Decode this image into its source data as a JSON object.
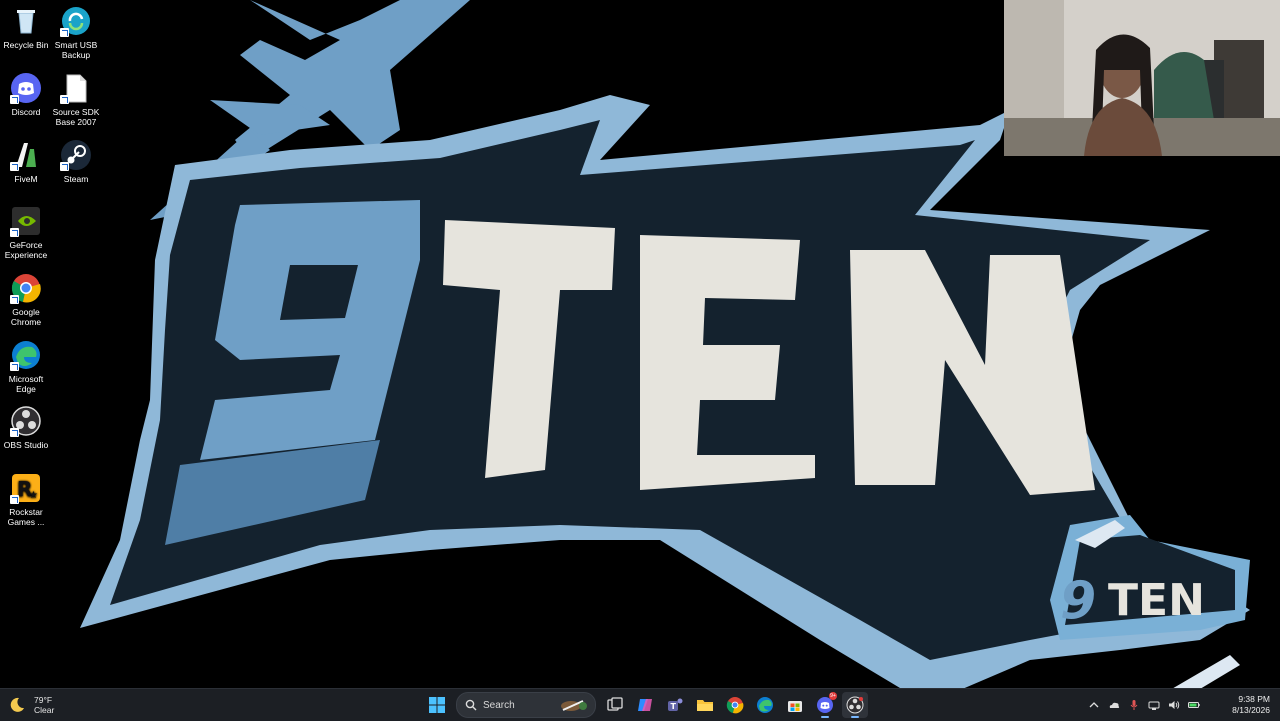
{
  "wallpaper": {
    "logo_text_nine": "9",
    "logo_text_word": "TEN",
    "small_logo_nine": "9",
    "small_logo_word": "TEN",
    "colors": {
      "light_blue": "#6f9fc6",
      "outline_blue": "#8fb8d8",
      "navy": "#14222e",
      "cream": "#e6e4dd"
    }
  },
  "desktop": {
    "icons": [
      {
        "label_line1": "Recycle Bin",
        "label_line2": "",
        "icon": "recycle-bin-icon"
      },
      {
        "label_line1": "Smart USB",
        "label_line2": "Backup",
        "icon": "smart-usb-backup-icon"
      },
      {
        "label_line1": "Discord",
        "label_line2": "",
        "icon": "discord-icon"
      },
      {
        "label_line1": "Source SDK",
        "label_line2": "Base 2007",
        "icon": "document-icon"
      },
      {
        "label_line1": "FiveM",
        "label_line2": "",
        "icon": "fivem-icon"
      },
      {
        "label_line1": "Steam",
        "label_line2": "",
        "icon": "steam-icon"
      },
      {
        "label_line1": "GeForce",
        "label_line2": "Experience",
        "icon": "geforce-icon"
      },
      {
        "label_line1": "Google",
        "label_line2": "Chrome",
        "icon": "chrome-icon"
      },
      {
        "label_line1": "Microsoft",
        "label_line2": "Edge",
        "icon": "edge-icon"
      },
      {
        "label_line1": "OBS Studio",
        "label_line2": "",
        "icon": "obs-icon"
      },
      {
        "label_line1": "Rockstar",
        "label_line2": "Games ...",
        "icon": "rockstar-icon"
      }
    ]
  },
  "taskbar": {
    "weather": {
      "temperature": "79°F",
      "condition": "Clear",
      "icon": "moon-icon"
    },
    "search": {
      "label": "Search"
    },
    "apps": [
      "start-icon",
      "search-icon",
      "task-view-icon",
      "copilot-icon",
      "teams-icon",
      "file-explorer-icon",
      "chrome-icon",
      "edge-icon",
      "store-icon",
      "discord-icon",
      "obs-icon"
    ],
    "discord_badge": "9+",
    "tray_icons": [
      "chevron-up-icon",
      "onedrive-icon",
      "mic-icon",
      "network-icon",
      "volume-icon",
      "battery-icon"
    ],
    "clock": {
      "time": "9:38 PM",
      "date": "8/13/2026"
    }
  }
}
